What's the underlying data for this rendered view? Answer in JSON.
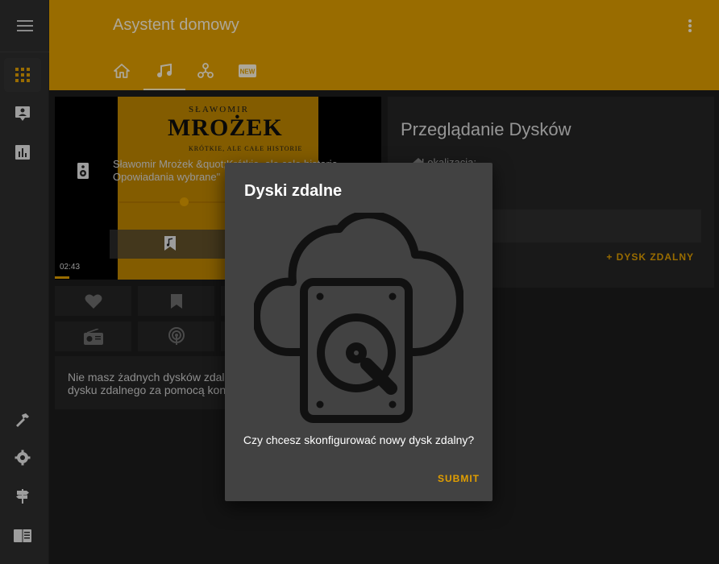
{
  "app": {
    "title": "Asystent domowy"
  },
  "colors": {
    "accent": "#e29f00",
    "header": "#e29f00",
    "sidebar": "#2e2e2e",
    "background": "#1c1c1c",
    "card": "#262626",
    "dialog": "#424242"
  },
  "sidebar": {
    "items": [
      {
        "icon": "menu-icon"
      },
      {
        "icon": "apps-grid-icon",
        "active": true
      },
      {
        "icon": "account-box-icon"
      },
      {
        "icon": "bar-chart-icon"
      },
      {
        "icon": "hammer-icon"
      },
      {
        "icon": "gear-icon"
      },
      {
        "icon": "signpost-icon"
      },
      {
        "icon": "book-open-icon"
      }
    ]
  },
  "tabs": [
    {
      "icon": "home-icon"
    },
    {
      "icon": "music-note-icon",
      "active": true
    },
    {
      "icon": "hub-icon"
    },
    {
      "icon": "new-badge-icon"
    }
  ],
  "player": {
    "cover_line1": "SŁAWOMIR",
    "cover_line2": "MROŻEK",
    "cover_line3": "KRÓTKIE, ALE CAŁE HISTORIE",
    "track_title": "Sławomir Mrożek &quot;Krótkie, ale całe historie. Opowiadania wybrane\"",
    "time": "02:43",
    "progress": 0.04
  },
  "tiles": [
    {
      "icon": "heart-icon"
    },
    {
      "icon": "bookmark-icon"
    },
    {
      "icon": "radio-icon"
    },
    {
      "icon": "podcast-icon"
    }
  ],
  "info": {
    "text": "Nie masz żadnych dysków zdalnych. Dodaj połączenie do dysku zdalnego za pomocą konfiguracji."
  },
  "browse": {
    "heading": "Przeglądanie Dysków",
    "folder_label": "Lokalizacja:",
    "add_button": "+ DYSK ZDALNY"
  },
  "dialog": {
    "title": "Dyski zdalne",
    "question": "Czy chcesz skonfigurować nowy dysk zdalny?",
    "submit": "SUBMIT"
  }
}
